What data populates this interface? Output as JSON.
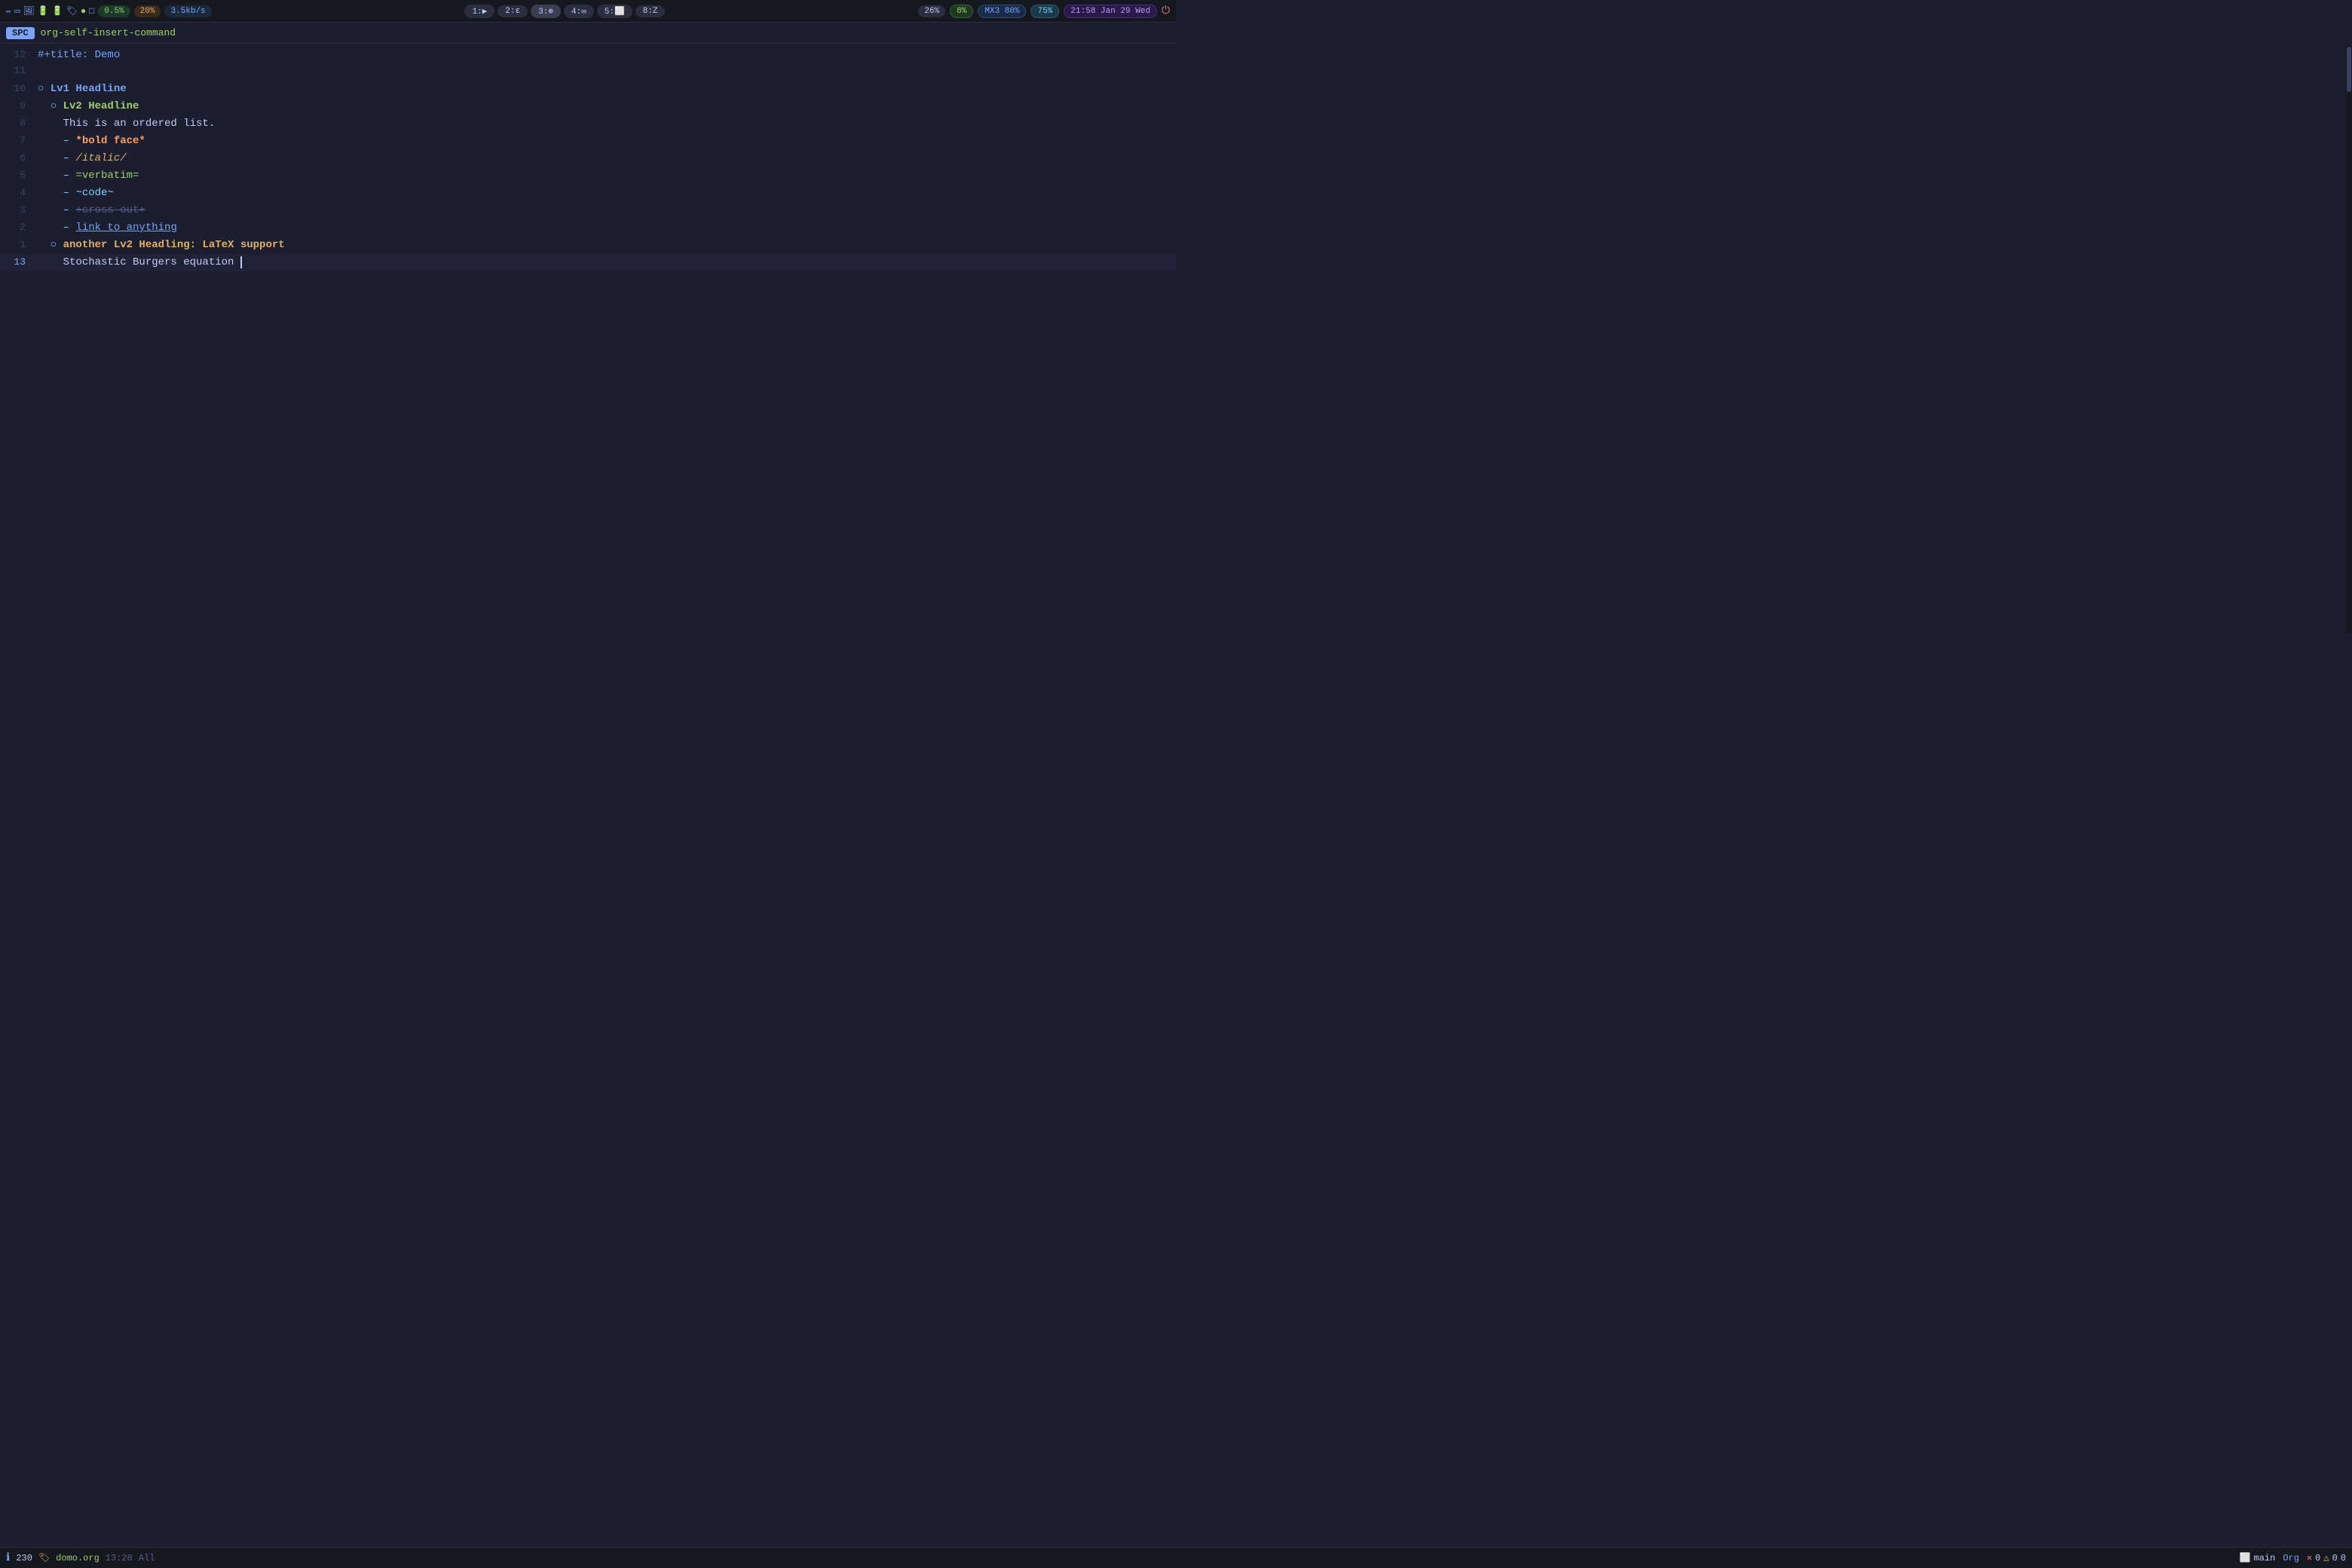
{
  "topbar": {
    "icons": [
      "✏",
      "⬜",
      "🖼",
      "🔋",
      "🔋",
      "🏷",
      "🟢",
      "⬜"
    ],
    "battery_percent": "0.5%",
    "cpu_percent": "20%",
    "network": "3.5kb/s",
    "workspaces": [
      {
        "id": "1",
        "label": "1:▶",
        "active": false
      },
      {
        "id": "2",
        "label": "2:ε",
        "active": false
      },
      {
        "id": "3",
        "label": "3:🌐",
        "active": false
      },
      {
        "id": "4",
        "label": "4:✉",
        "active": false
      },
      {
        "id": "5",
        "label": "5:💻",
        "active": false
      },
      {
        "id": "8",
        "label": "8:Z",
        "active": false
      }
    ],
    "mem1": "26%",
    "mem2": "8%",
    "mx3": "MX3 80%",
    "battery": "75%",
    "datetime": "21:58 Jan 29 Wed"
  },
  "modebar": {
    "mode": "SPC",
    "command": "org-self-insert-command"
  },
  "editor": {
    "lines": [
      {
        "num": "12",
        "active": false,
        "content": [
          {
            "text": "#+title: ",
            "class": "org-title-prefix"
          },
          {
            "text": "Demo",
            "class": "org-title-text"
          }
        ]
      },
      {
        "num": "11",
        "active": false,
        "content": [
          {
            "text": "",
            "class": "org-plain"
          }
        ]
      },
      {
        "num": "10",
        "active": false,
        "content": [
          {
            "text": "○ ",
            "class": "org-heading-bullet"
          },
          {
            "text": "Lv1 Headline",
            "class": "org-h1"
          }
        ]
      },
      {
        "num": "9",
        "active": false,
        "content": [
          {
            "text": "  ○ ",
            "class": "org-heading-bullet"
          },
          {
            "text": "Lv2 Headline",
            "class": "org-h2"
          }
        ]
      },
      {
        "num": "8",
        "active": false,
        "content": [
          {
            "text": "    This is an ordered list.",
            "class": "org-plain"
          }
        ]
      },
      {
        "num": "7",
        "active": false,
        "content": [
          {
            "text": "    – ",
            "class": "org-list-dash"
          },
          {
            "text": "*bold face*",
            "class": "org-bold"
          }
        ]
      },
      {
        "num": "6",
        "active": false,
        "content": [
          {
            "text": "    – ",
            "class": "org-list-dash"
          },
          {
            "text": "/italic/",
            "class": "org-italic"
          }
        ]
      },
      {
        "num": "5",
        "active": false,
        "content": [
          {
            "text": "    – ",
            "class": "org-list-dash"
          },
          {
            "text": "=verbatim=",
            "class": "org-verbatim"
          }
        ]
      },
      {
        "num": "4",
        "active": false,
        "content": [
          {
            "text": "    – ",
            "class": "org-list-dash"
          },
          {
            "text": "~code~",
            "class": "org-code"
          }
        ]
      },
      {
        "num": "3",
        "active": false,
        "content": [
          {
            "text": "    – ",
            "class": "org-list-dash"
          },
          {
            "text": "+cross-out+",
            "class": "org-strikethrough"
          }
        ]
      },
      {
        "num": "2",
        "active": false,
        "content": [
          {
            "text": "    – ",
            "class": "org-list-dash"
          },
          {
            "text": "link to anything",
            "class": "org-link"
          }
        ]
      },
      {
        "num": "1",
        "active": false,
        "content": [
          {
            "text": "  ○ ",
            "class": "org-heading-bullet"
          },
          {
            "text": "another Lv2 Headling: LaTeX support",
            "class": "org-h2-another"
          }
        ]
      },
      {
        "num": "13",
        "active": true,
        "content": [
          {
            "text": "    Stochastic Burgers equation ",
            "class": "org-plain"
          },
          {
            "text": "|",
            "class": "cursor"
          }
        ]
      }
    ]
  },
  "statusbar": {
    "line_col": "230",
    "branch_name": "domo.org",
    "time": "13:28",
    "encoding": "All",
    "workspace": "main",
    "mode": "Org",
    "errors": "0",
    "warnings": "0",
    "infos": "0"
  }
}
